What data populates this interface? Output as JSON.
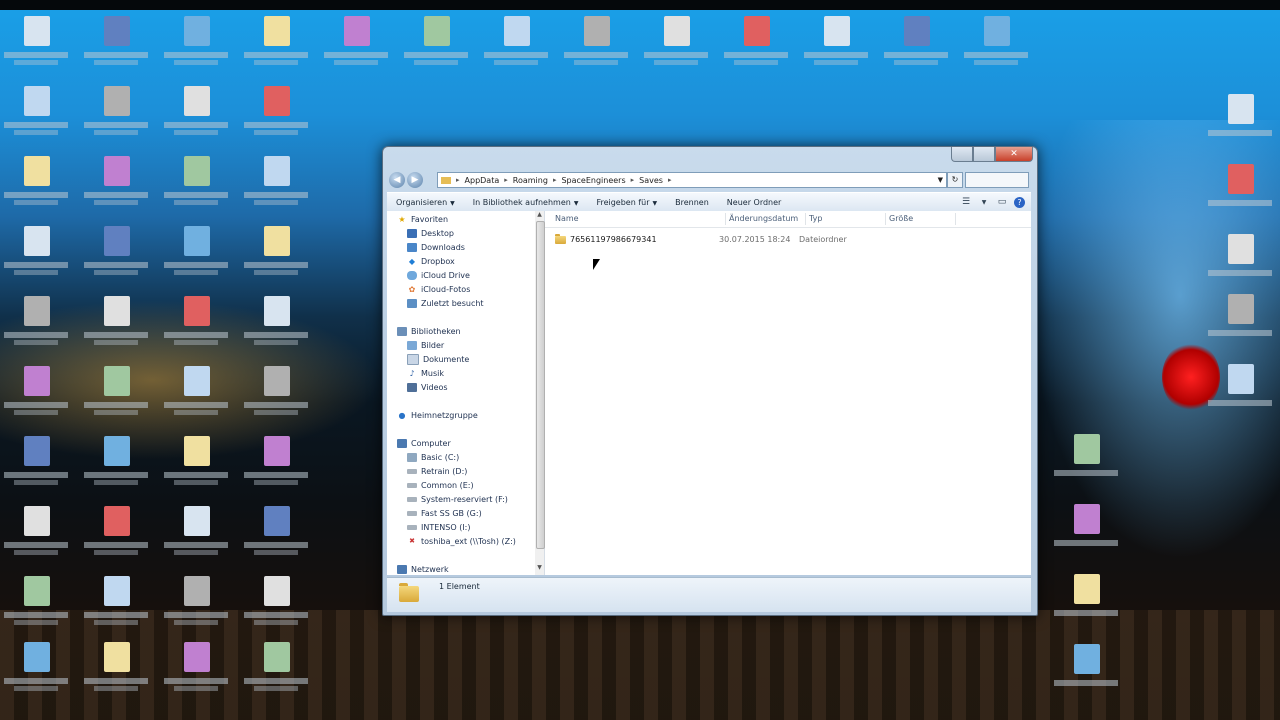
{
  "window": {
    "address": {
      "segments": [
        "AppData",
        "Roaming",
        "SpaceEngineers",
        "Saves"
      ]
    },
    "toolbar": {
      "organize": "Organisieren",
      "include_library": "In Bibliothek aufnehmen",
      "share": "Freigeben für",
      "burn": "Brennen",
      "new_folder": "Neuer Ordner"
    },
    "nav": {
      "favorites": "Favoriten",
      "favorites_items": [
        "Desktop",
        "Downloads",
        "Dropbox",
        "iCloud Drive",
        "iCloud-Fotos",
        "Zuletzt besucht"
      ],
      "libraries": "Bibliotheken",
      "libraries_items": [
        "Bilder",
        "Dokumente",
        "Musik",
        "Videos"
      ],
      "homegroup": "Heimnetzgruppe",
      "computer": "Computer",
      "computer_items": [
        "Basic (C:)",
        "Retrain (D:)",
        "Common (E:)",
        "System-reserviert (F:)",
        "Fast SS GB (G:)",
        "INTENSO (I:)",
        "toshiba_ext (\\\\Tosh) (Z:)"
      ],
      "network": "Netzwerk"
    },
    "columns": {
      "name": "Name",
      "modified": "Änderungsdatum",
      "type": "Typ",
      "size": "Größe"
    },
    "files": [
      {
        "name": "76561197986679341",
        "modified": "30.07.2015 18:24",
        "type": "Dateiordner"
      }
    ],
    "status": {
      "count": "1 Element"
    }
  },
  "colors": {
    "window_frame": "#bcd0e4",
    "selection": "#dde9f6",
    "close_button": "#c8402a",
    "folder": "#e6bd55"
  }
}
